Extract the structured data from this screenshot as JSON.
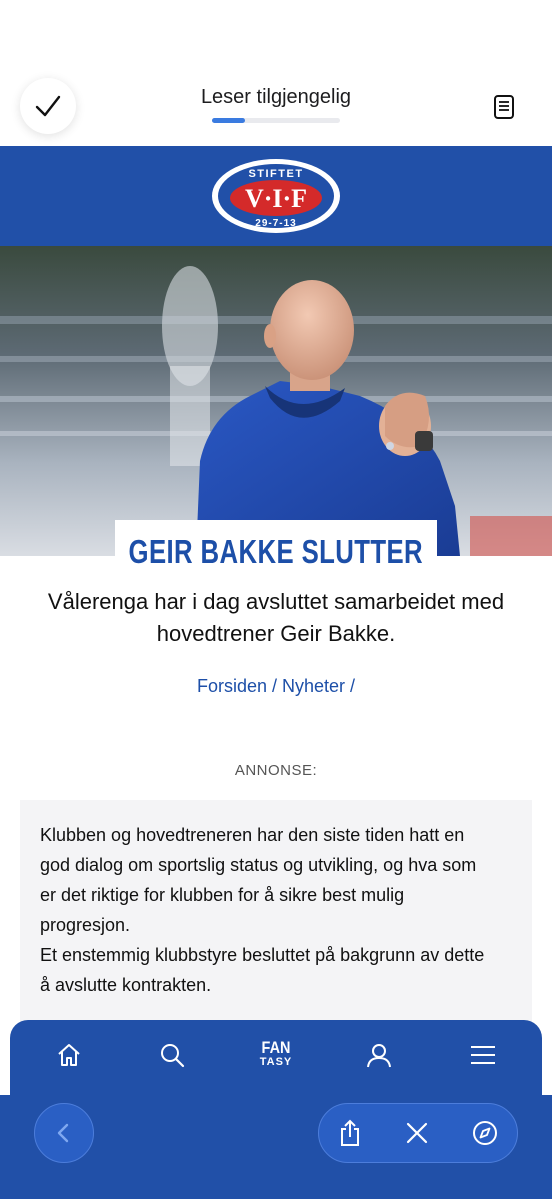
{
  "reader": {
    "title": "Leser tilgjengelig",
    "progress_percent": 26,
    "done_icon": "checkmark-icon",
    "reader_icon": "reader-document-icon"
  },
  "logo": {
    "top_text": "STIFTET",
    "monogram": "V·I·F",
    "date": "29-7-13"
  },
  "article": {
    "headline": "GEIR BAKKE SLUTTER",
    "lead": "Vålerenga har i dag avsluttet samarbeidet med hovedtrener Geir Bakke.",
    "breadcrumb": "Forsiden / Nyheter /",
    "ad_label": "ANNONSE:",
    "paragraphs": [
      "Klubben og hovedtreneren har den siste tiden hatt en god dialog om sportslig status og utvikling, og hva som er det riktige for klubben for å sikre best mulig progresjon.",
      "Et enstemmig klubbstyre besluttet på bakgrunn av dette å avslutte kontrakten."
    ]
  },
  "nav": {
    "items": [
      "home-icon",
      "search-icon",
      "fantasy",
      "profile-icon",
      "menu-icon"
    ],
    "fantasy_line1": "FAN",
    "fantasy_line2": "TASY"
  },
  "browser": {
    "buttons": [
      "back-icon",
      "share-icon",
      "close-icon",
      "compass-icon"
    ]
  },
  "colors": {
    "brand_blue": "#2150a8",
    "headline_blue": "#1d4fa8",
    "logo_red": "#d42a2a",
    "progress_blue": "#3a7be0"
  }
}
